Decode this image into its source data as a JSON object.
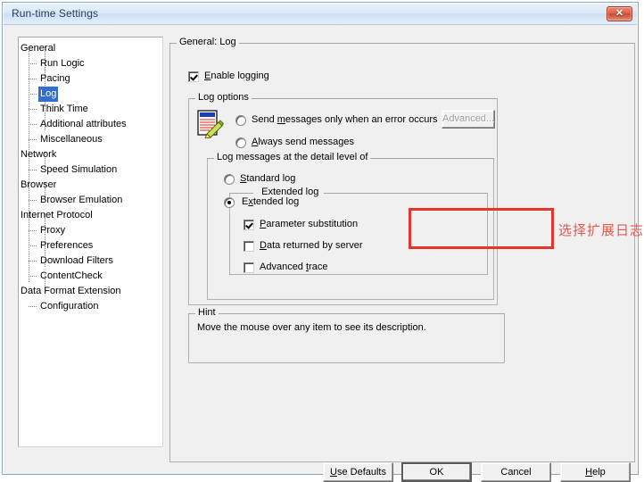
{
  "window": {
    "title": "Run-time Settings",
    "close_label": "✕"
  },
  "tree": {
    "items": [
      {
        "label": "General",
        "level": 0,
        "selected": false
      },
      {
        "label": "Run Logic",
        "level": 1,
        "selected": false
      },
      {
        "label": "Pacing",
        "level": 1,
        "selected": false
      },
      {
        "label": "Log",
        "level": 1,
        "selected": true
      },
      {
        "label": "Think Time",
        "level": 1,
        "selected": false
      },
      {
        "label": "Additional attributes",
        "level": 1,
        "selected": false
      },
      {
        "label": "Miscellaneous",
        "level": 1,
        "selected": false
      },
      {
        "label": "Network",
        "level": 0,
        "selected": false
      },
      {
        "label": "Speed Simulation",
        "level": 1,
        "selected": false
      },
      {
        "label": "Browser",
        "level": 0,
        "selected": false
      },
      {
        "label": "Browser Emulation",
        "level": 1,
        "selected": false
      },
      {
        "label": "Internet Protocol",
        "level": 0,
        "selected": false
      },
      {
        "label": "Proxy",
        "level": 1,
        "selected": false
      },
      {
        "label": "Preferences",
        "level": 1,
        "selected": false
      },
      {
        "label": "Download Filters",
        "level": 1,
        "selected": false
      },
      {
        "label": "ContentCheck",
        "level": 1,
        "selected": false
      },
      {
        "label": "Data Format Extension",
        "level": 0,
        "selected": false
      },
      {
        "label": "Configuration",
        "level": 1,
        "selected": false
      }
    ]
  },
  "panel": {
    "title": "General: Log",
    "enable_logging": {
      "label": "Enable logging",
      "checked": true
    },
    "log_options": {
      "title": "Log options",
      "icon": "log-notepad-pencil-icon",
      "radio_error_only": {
        "label": "Send messages only when an error occurs",
        "checked": false
      },
      "radio_always": {
        "label": "Always send messages",
        "checked": true
      },
      "advanced_button": {
        "label": "Advanced...",
        "disabled": true
      },
      "detail_level": {
        "title": "Log messages at the detail level of",
        "radio_standard": {
          "label": "Standard log",
          "checked": false
        },
        "radio_extended": {
          "label": "Extended log",
          "checked": true
        },
        "checkbox_parameter_substitution": {
          "label": "Parameter substitution",
          "checked": true
        },
        "checkbox_data_returned": {
          "label": "Data returned by server",
          "checked": false
        },
        "checkbox_advanced_trace": {
          "label": "Advanced trace",
          "checked": false
        }
      }
    },
    "hint": {
      "title": "Hint",
      "text": "Move the mouse over any item to see its description."
    }
  },
  "annotation": {
    "text": "选择扩展日志,参数替换;",
    "color": "#e8584e",
    "box_color": "#e8342a"
  },
  "footer": {
    "use_defaults": "Use Defaults",
    "ok": "OK",
    "cancel": "Cancel",
    "help": "Help"
  }
}
